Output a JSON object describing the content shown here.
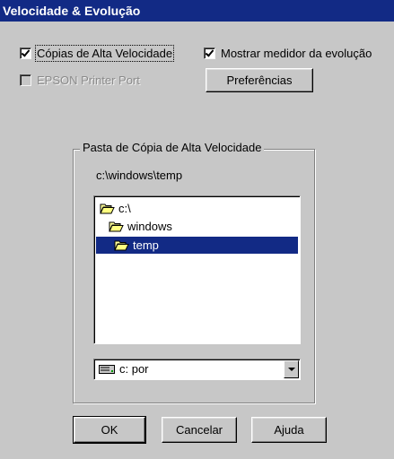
{
  "window": {
    "title": "Velocidade & Evolução"
  },
  "options": {
    "high_speed_copies": {
      "label": "Cópias de Alta Velocidade",
      "checked": true
    },
    "show_progress_meter": {
      "label": "Mostrar medidor da evolução",
      "checked": true
    },
    "epson_printer_port": {
      "label": "EPSON Printer Port",
      "checked": false,
      "disabled": true
    }
  },
  "buttons": {
    "preferences": "Preferências",
    "ok": "OK",
    "cancel": "Cancelar",
    "help": "Ajuda"
  },
  "folder_group": {
    "title": "Pasta de Cópia de Alta Velocidade",
    "current_path": "c:\\windows\\temp",
    "directories": [
      {
        "name": "c:\\",
        "icon": "open-folder-icon",
        "selected": false
      },
      {
        "name": "windows",
        "icon": "open-folder-icon",
        "selected": false
      },
      {
        "name": "temp",
        "icon": "open-folder-icon",
        "selected": true
      }
    ],
    "drive": {
      "value": "c:  por",
      "icon": "drive-icon"
    }
  },
  "colors": {
    "title_bar": "#122a85",
    "selection": "#122a85",
    "dialog_bg": "#c7c7c7"
  }
}
